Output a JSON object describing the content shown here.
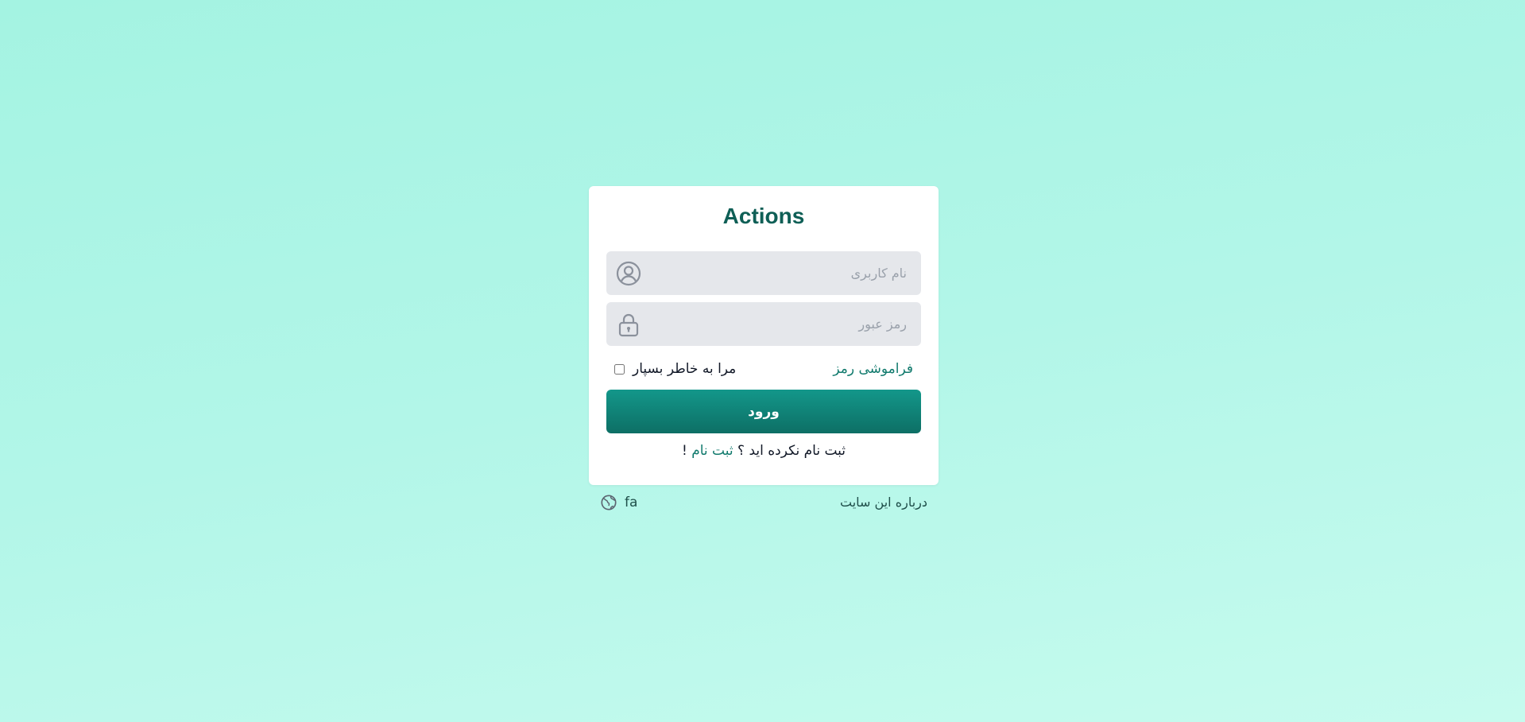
{
  "login": {
    "title": "Actions",
    "username_placeholder": "نام کاربری",
    "password_placeholder": "رمز عبور",
    "forgot_password": "فراموشی رمز",
    "remember_me": "مرا به خاطر بسپار",
    "remember_checked": false,
    "submit_label": "ورود",
    "signup_prompt": "ثبت نام نکرده اید ؟",
    "signup_link": "ثبت نام",
    "signup_suffix": "!"
  },
  "footer": {
    "about_label": "درباره این سایت",
    "language_code": "fa"
  },
  "icons": {
    "username": "user-circle-icon",
    "password": "lock-icon",
    "language": "globe-icon"
  },
  "colors": {
    "brand": "#117a6d",
    "button_top": "#13978a",
    "button_bottom": "#0d6f65",
    "background": "#b2f6e8"
  }
}
